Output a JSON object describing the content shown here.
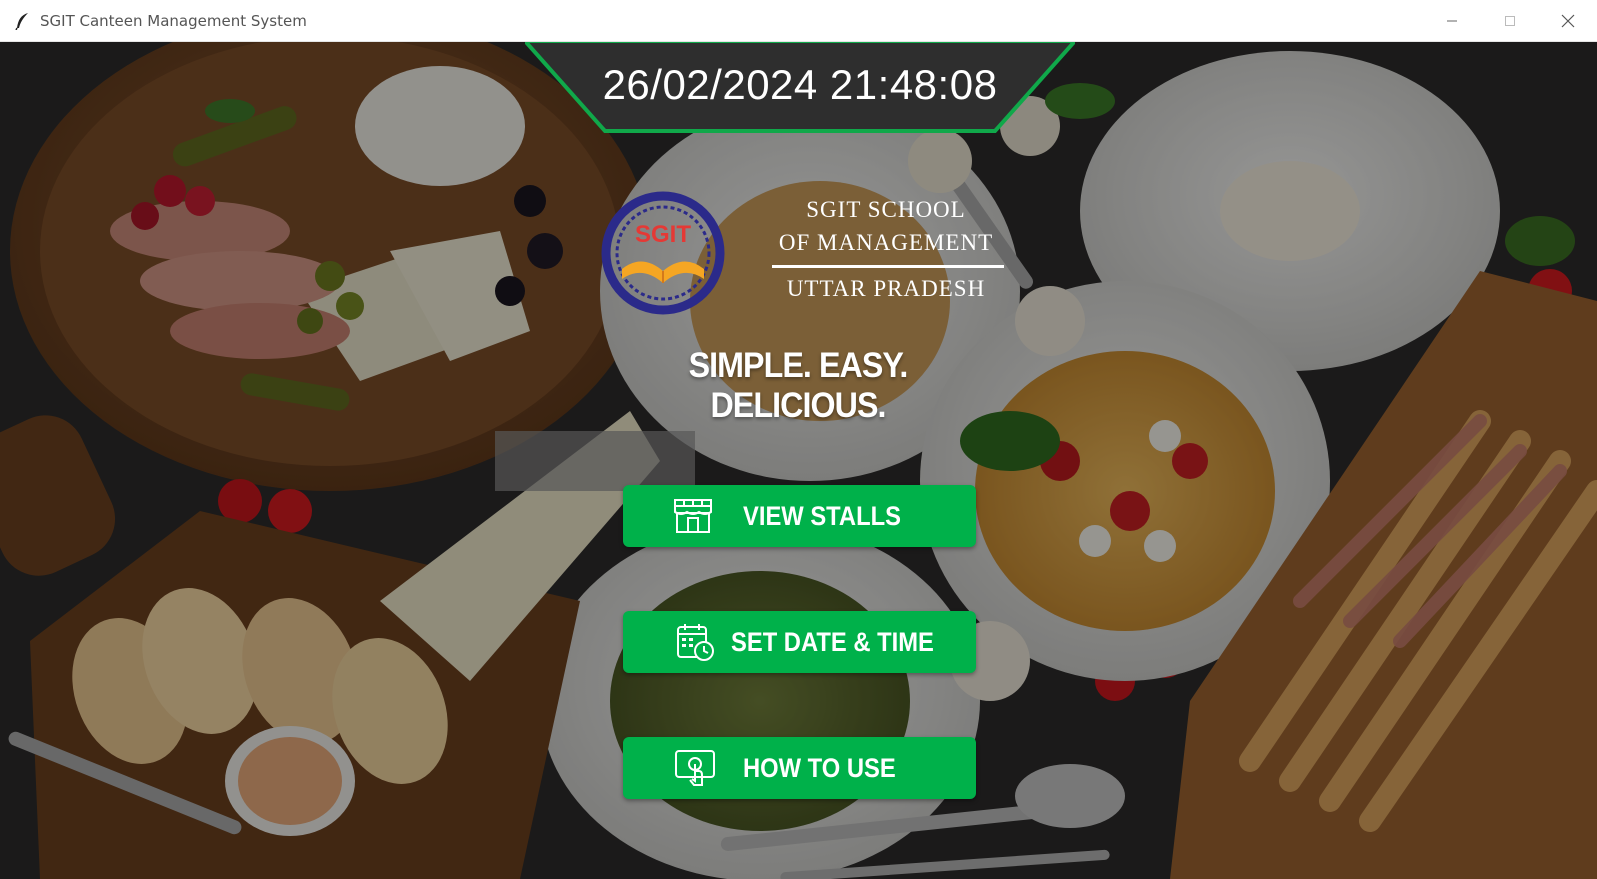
{
  "window": {
    "title": "SGIT Canteen Management System",
    "app_icon": "feather-icon",
    "controls": [
      "minimize-icon",
      "maximize-icon",
      "close-icon"
    ]
  },
  "clock": {
    "datetime": "26/02/2024 21:48:08"
  },
  "logo": {
    "emblem_text": "SGIT",
    "school_line1": "SGIT SCHOOL",
    "school_line2": "OF MANAGEMENT",
    "school_line3": "UTTAR PRADESH"
  },
  "tagline": "SIMPLE. EASY. DELICIOUS.",
  "buttons": {
    "view_stalls": {
      "label": "VIEW STALLS",
      "icon": "storefront-icon"
    },
    "set_date_time": {
      "label": "SET DATE & TIME",
      "icon": "calendar-clock-icon"
    },
    "how_to_use": {
      "label": "HOW TO USE",
      "icon": "touch-screen-icon"
    }
  },
  "colors": {
    "accent_green": "#00b14a",
    "clock_bg": "#2e2e2e",
    "clock_border": "#10a84a",
    "logo_navy": "#2b2a8a",
    "logo_orange": "#f5a623",
    "logo_red": "#e53935"
  }
}
